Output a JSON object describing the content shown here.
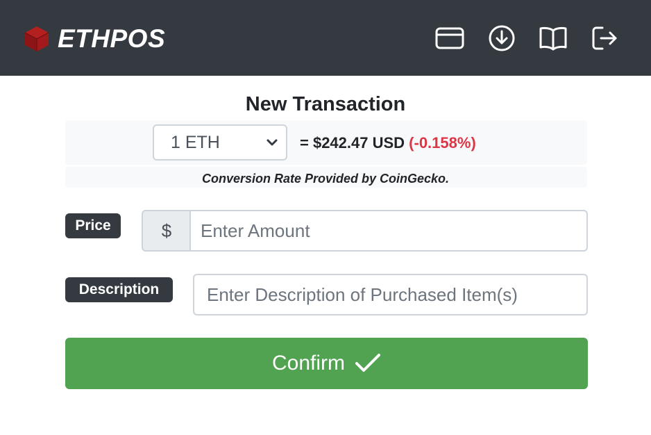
{
  "header": {
    "brand_name": "ETHPOS",
    "logo_icon": "cube-icon",
    "nav_icons": [
      "credit-card-icon",
      "download-circle-icon",
      "book-open-icon",
      "logout-icon"
    ]
  },
  "transaction": {
    "title": "New Transaction",
    "currency_selected": "1 ETH",
    "rate_prefix": "= $242.47 USD",
    "rate_change": "(-0.158%)",
    "credit": "Conversion Rate Provided by CoinGecko."
  },
  "price": {
    "label": "Price",
    "currency_symbol": "$",
    "placeholder": "Enter Amount"
  },
  "description": {
    "label": "Description",
    "placeholder": "Enter Description of Purchased Item(s)"
  },
  "confirm": {
    "label": "Confirm",
    "icon": "checkmark-icon"
  },
  "colors": {
    "navbar": "#343a40",
    "confirm_green": "#51a351",
    "negative_red": "#dc3545",
    "logo_red": "#a8191c"
  }
}
